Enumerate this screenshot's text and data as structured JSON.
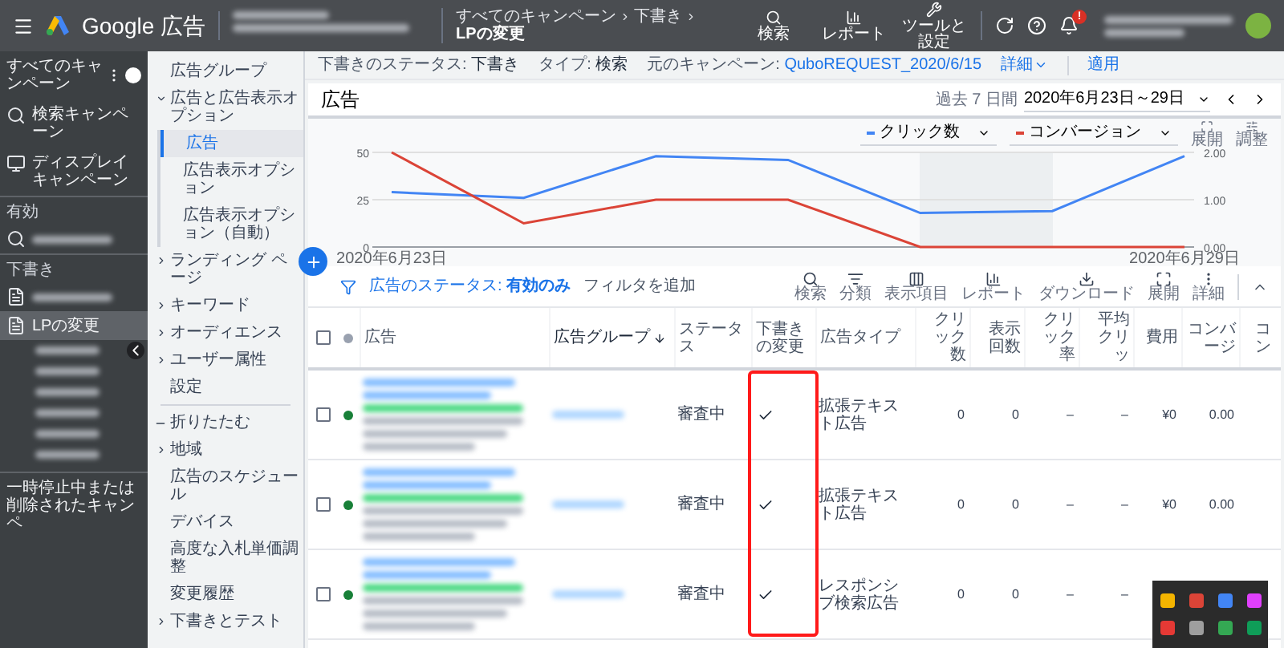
{
  "top_bar": {
    "product": "Google 広告",
    "breadcrumb": [
      "すべてのキャンペーン",
      "下書き"
    ],
    "page_title": "LPの変更",
    "actions": [
      {
        "kind": "search",
        "label": "検索"
      },
      {
        "kind": "report",
        "label": "レポート"
      },
      {
        "kind": "tools",
        "label": "ツールと設定"
      }
    ],
    "notification_badge": "!"
  },
  "sidebar": {
    "header": "すべてのキャンペーン",
    "items": [
      {
        "kind": "search",
        "label": "検索キャンペーン",
        "selected": false
      },
      {
        "kind": "display",
        "label": "ディスプレイキャンペーン",
        "selected": false
      }
    ],
    "groups": [
      {
        "title": "有効",
        "items": [
          {
            "kind": "search",
            "selected": false
          }
        ]
      },
      {
        "title": "下書き",
        "items": [
          {
            "kind": "draft",
            "selected": false
          },
          {
            "kind": "draft",
            "label": "LPの変更",
            "selected": true,
            "children": [
              {
                "selected": false
              },
              {
                "selected": false
              },
              {
                "selected": false
              },
              {
                "selected": false
              },
              {
                "selected": false
              },
              {
                "selected": false
              }
            ]
          }
        ]
      }
    ],
    "footer": "一時停止中または削除されたキャンペ"
  },
  "nav": [
    {
      "label": "広告グループ",
      "selected": false
    },
    {
      "label": "広告と広告表示オプション",
      "selected": false,
      "expanded": true,
      "children": [
        {
          "label": "広告",
          "selected": true
        },
        {
          "label": "広告表示オプション",
          "selected": false
        },
        {
          "label": "広告表示オプション（自動）",
          "selected": false
        }
      ]
    },
    {
      "label": "ランディング ページ",
      "selected": false,
      "expanded": false
    },
    {
      "label": "キーワード",
      "selected": false,
      "expanded": false
    },
    {
      "label": "オーディエンス",
      "selected": false,
      "expanded": false
    },
    {
      "label": "ユーザー属性",
      "selected": false,
      "expanded": false
    },
    {
      "label": "設定",
      "selected": false
    },
    {
      "label": "折りたたむ",
      "kind": "collapse",
      "selected": false
    },
    {
      "label": "地域",
      "selected": false,
      "expanded": false
    },
    {
      "label": "広告のスケジュール",
      "selected": false
    },
    {
      "label": "デバイス",
      "selected": false
    },
    {
      "label": "高度な入札単価調整",
      "selected": false
    },
    {
      "label": "変更履歴",
      "selected": false
    },
    {
      "label": "下書きとテスト",
      "selected": false,
      "expanded": false
    }
  ],
  "draft_bar": {
    "status_label": "下書きのステータス:",
    "status": "下書き",
    "type_label": "タイプ:",
    "type": "検索",
    "source_label": "元のキャンペーン:",
    "source": "QuboREQUEST_2020/6/15",
    "details": "詳細",
    "apply": "適用"
  },
  "panel": {
    "title": "広告",
    "range_label": "過去 7 日間",
    "range": "2020年6月23日～29日",
    "chart_tools": [
      {
        "kind": "expand",
        "label": "展開"
      },
      {
        "kind": "adjust",
        "label": "調整"
      }
    ],
    "chart_data": {
      "type": "line",
      "categories": [
        "2020年6月23日",
        null,
        null,
        null,
        null,
        null,
        "2020年6月29日"
      ],
      "ylim": [
        0,
        50
      ],
      "yticks": [
        0,
        25,
        50
      ],
      "y2lim": [
        0,
        2
      ],
      "y2ticks": [
        {
          "value": 0,
          "label": "0.00"
        },
        {
          "value": 1,
          "label": "1.00"
        },
        {
          "value": 2,
          "label": "2.00"
        }
      ],
      "series": [
        {
          "name": "クリック数",
          "color": "#4285f4",
          "values": [
            29,
            26,
            48,
            46,
            18,
            19,
            48
          ]
        },
        {
          "name": "コンバージョン",
          "color": "#db4437",
          "axis": "y2",
          "values": [
            2,
            0.5,
            1,
            1,
            0,
            0,
            0
          ]
        }
      ]
    },
    "filter_label": "広告のステータス:",
    "filter_value": "有効のみ",
    "add_filter": "フィルタを追加",
    "toolbar": [
      {
        "kind": "search",
        "label": "検索"
      },
      {
        "kind": "segment",
        "label": "分類"
      },
      {
        "kind": "columns",
        "label": "表示項目"
      },
      {
        "kind": "report",
        "label": "レポート"
      },
      {
        "kind": "download",
        "label": "ダウンロード"
      },
      {
        "kind": "expand",
        "label": "展開"
      },
      {
        "kind": "more",
        "label": "詳細"
      }
    ]
  },
  "table": {
    "all_checked": false,
    "columns": [
      "広告",
      "広告グループ",
      "ステータス",
      "下書きの変更",
      "広告タイプ",
      "クリック数",
      "表示回数",
      "クリック率",
      "平均クリッ",
      "費用",
      "コンバージ",
      "コン"
    ],
    "rows": [
      {
        "enabled": true,
        "checked": false,
        "status": "審査中",
        "changed": true,
        "type": "拡張テキスト広告",
        "clicks": "0",
        "impressions": "0",
        "ctr": "–",
        "avg_cpc": "–",
        "cost": "¥0",
        "conversions": "0.00"
      },
      {
        "enabled": true,
        "checked": false,
        "status": "審査中",
        "changed": true,
        "type": "拡張テキスト広告",
        "clicks": "0",
        "impressions": "0",
        "ctr": "–",
        "avg_cpc": "–",
        "cost": "¥0",
        "conversions": "0.00"
      },
      {
        "enabled": true,
        "checked": false,
        "status": "審査中",
        "changed": true,
        "type": "レスポンシブ検索広告",
        "clicks": "0",
        "impressions": "0",
        "ctr": "–",
        "avg_cpc": "–"
      }
    ]
  },
  "tray": {
    "apps": [
      {
        "color": "#f4b400"
      },
      {
        "color": "#db4437"
      },
      {
        "color": "#4285f4"
      },
      {
        "color": "#e040fb"
      },
      {
        "color": "#e53935"
      },
      {
        "color": "#9e9e9e"
      },
      {
        "color": "#34a853"
      },
      {
        "color": "#0f9d58"
      }
    ]
  }
}
